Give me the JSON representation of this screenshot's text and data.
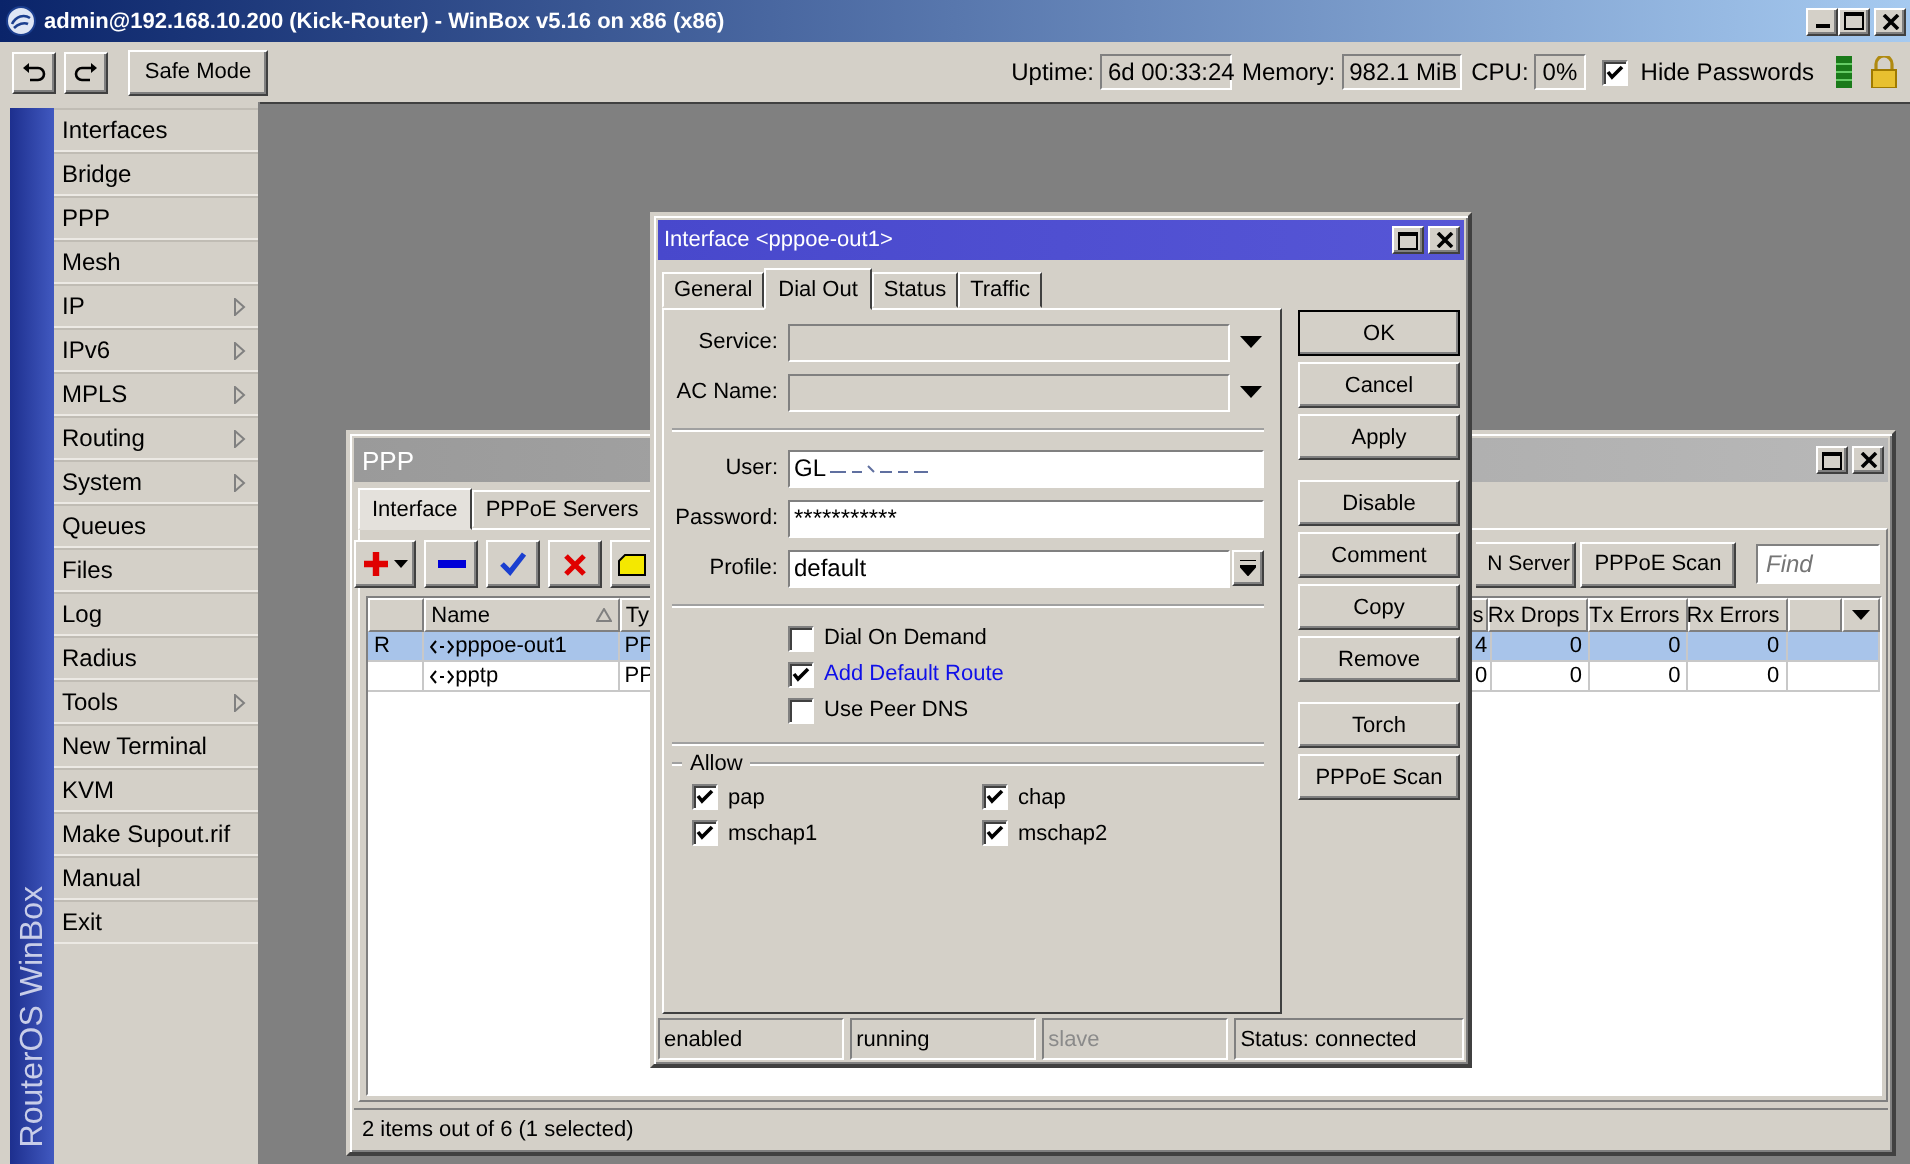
{
  "window": {
    "title": "admin@192.168.10.200 (Kick-Router) - WinBox v5.16 on x86 (x86)"
  },
  "toolbar": {
    "safe_mode": "Safe Mode",
    "uptime_label": "Uptime:",
    "uptime": "6d 00:33:24",
    "memory_label": "Memory:",
    "memory": "982.1 MiB",
    "cpu_label": "CPU:",
    "cpu": "0%",
    "hide_passwords": {
      "label": "Hide Passwords",
      "checked": true
    }
  },
  "brand": "RouterOS WinBox",
  "sidebar": {
    "items": [
      {
        "label": "Interfaces",
        "submenu": false
      },
      {
        "label": "Bridge",
        "submenu": false
      },
      {
        "label": "PPP",
        "submenu": false
      },
      {
        "label": "Mesh",
        "submenu": false
      },
      {
        "label": "IP",
        "submenu": true
      },
      {
        "label": "IPv6",
        "submenu": true
      },
      {
        "label": "MPLS",
        "submenu": true
      },
      {
        "label": "Routing",
        "submenu": true
      },
      {
        "label": "System",
        "submenu": true
      },
      {
        "label": "Queues",
        "submenu": false
      },
      {
        "label": "Files",
        "submenu": false
      },
      {
        "label": "Log",
        "submenu": false
      },
      {
        "label": "Radius",
        "submenu": false
      },
      {
        "label": "Tools",
        "submenu": true
      },
      {
        "label": "New Terminal",
        "submenu": false
      },
      {
        "label": "KVM",
        "submenu": false
      },
      {
        "label": "Make Supout.rif",
        "submenu": false
      },
      {
        "label": "Manual",
        "submenu": false
      },
      {
        "label": "Exit",
        "submenu": false
      }
    ]
  },
  "ppp_window": {
    "title": "PPP",
    "tabs": [
      {
        "label": "Interface",
        "selected": true
      },
      {
        "label": "PPPoE Servers",
        "selected": false
      }
    ],
    "buttons": [
      "N Server",
      "PPPoE Scan"
    ],
    "find": {
      "placeholder": "Find"
    },
    "table": {
      "columns": [
        "Name",
        "Ty",
        "s",
        "Rx Drops",
        "Tx Errors",
        "Rx Errors"
      ],
      "rows": [
        {
          "flag": "R",
          "name": "pppoe-out1",
          "type": "PP",
          "column_3": "4",
          "rx_drops": "0",
          "tx_errors": "0",
          "rx_errors": "0",
          "selected": true
        },
        {
          "flag": "",
          "name": "pptp",
          "type": "PP",
          "column_3": "0",
          "rx_drops": "0",
          "tx_errors": "0",
          "rx_errors": "0",
          "selected": false
        }
      ]
    },
    "status": "2 items out of 6 (1 selected)"
  },
  "dialog": {
    "title": "Interface <pppoe-out1>",
    "tabs": [
      {
        "label": "General",
        "selected": false
      },
      {
        "label": "Dial Out",
        "selected": true
      },
      {
        "label": "Status",
        "selected": false
      },
      {
        "label": "Traffic",
        "selected": false
      }
    ],
    "fields": [
      {
        "label": "Service:",
        "kind": "combo",
        "disabled": true
      },
      {
        "label": "AC Name:",
        "kind": "combo",
        "disabled": true
      },
      {
        "label": "User:",
        "kind": "text",
        "value": "GL",
        "disabled": false
      },
      {
        "label": "Password:",
        "kind": "text",
        "value": "***********",
        "disabled": false
      },
      {
        "label": "Profile:",
        "kind": "select",
        "value": "default",
        "disabled": false
      }
    ],
    "options": [
      {
        "label": "Dial On Demand",
        "checked": false,
        "highlighted": false
      },
      {
        "label": "Add Default Route",
        "checked": true,
        "highlighted": true
      },
      {
        "label": "Use Peer DNS",
        "checked": false,
        "highlighted": false
      }
    ],
    "allow": {
      "label": "Allow",
      "items": [
        {
          "label": "pap",
          "checked": true
        },
        {
          "label": "chap",
          "checked": true
        },
        {
          "label": "mschap1",
          "checked": true
        },
        {
          "label": "mschap2",
          "checked": true
        }
      ]
    },
    "buttons": [
      "OK",
      "Cancel",
      "Apply",
      "Disable",
      "Comment",
      "Copy",
      "Remove",
      "Torch",
      "PPPoE Scan"
    ],
    "status": [
      {
        "text": "enabled",
        "disabled": false
      },
      {
        "text": "running",
        "disabled": false
      },
      {
        "text": "slave",
        "disabled": true
      },
      {
        "text": "Status: connected",
        "disabled": false
      }
    ]
  }
}
